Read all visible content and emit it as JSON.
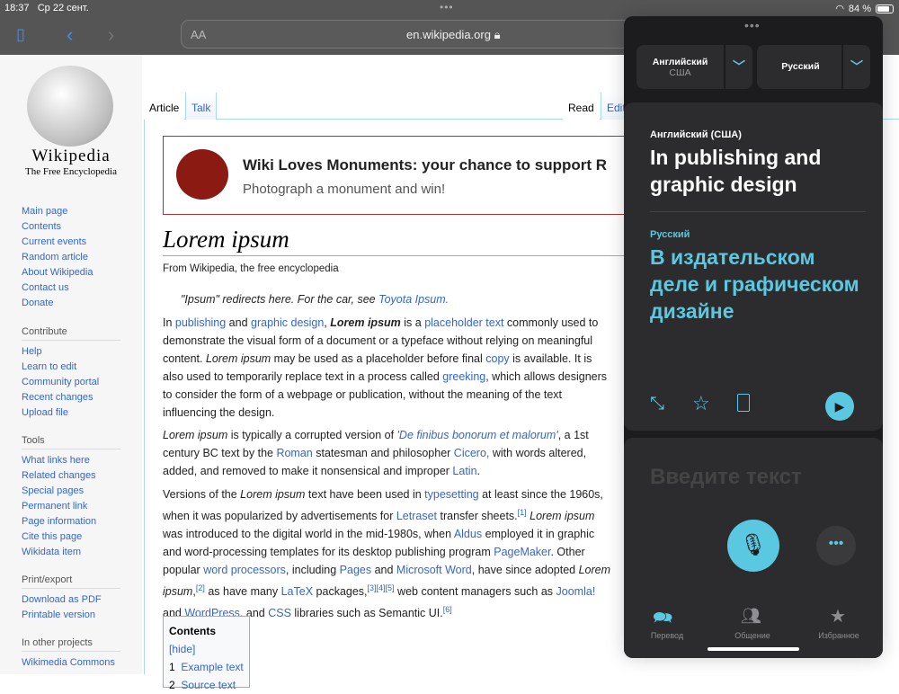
{
  "status": {
    "time": "18:37",
    "date": "Ср 22 сент.",
    "battery": "84 %",
    "battery_level": 0.84
  },
  "browser": {
    "text_size": "AA",
    "url": "en.wikipedia.org"
  },
  "wiki": {
    "logo_title": "Wikipedia",
    "logo_subtitle": "The Free Encyclopedia",
    "nav": [
      "Main page",
      "Contents",
      "Current events",
      "Random article",
      "About Wikipedia",
      "Contact us",
      "Donate"
    ],
    "contribute": {
      "heading": "Contribute",
      "items": [
        "Help",
        "Learn to edit",
        "Community portal",
        "Recent changes",
        "Upload file"
      ]
    },
    "tools": {
      "heading": "Tools",
      "items": [
        "What links here",
        "Related changes",
        "Special pages",
        "Permanent link",
        "Page information",
        "Cite this page",
        "Wikidata item"
      ]
    },
    "print": {
      "heading": "Print/export",
      "items": [
        "Download as PDF",
        "Printable version"
      ]
    },
    "other": {
      "heading": "In other projects",
      "items": [
        "Wikimedia Commons"
      ]
    },
    "tabs": {
      "article": "Article",
      "talk": "Talk",
      "read": "Read",
      "edit": "Edit"
    },
    "banner": {
      "title": "Wiki Loves Monuments: your chance to support R",
      "subtitle": "Photograph a monument and win!"
    },
    "title": "Lorem ipsum",
    "from": "From Wikipedia, the free encyclopedia",
    "hatnote": [
      {
        "t": "\"Ipsum\" redirects here. For the car, see "
      },
      {
        "t": "Toyota Ipsum.",
        "l": 1
      }
    ],
    "paragraphs": [
      [
        {
          "t": "In "
        },
        {
          "t": "publishing",
          "l": 1
        },
        {
          "t": " and "
        },
        {
          "t": "graphic design",
          "l": 1
        },
        {
          "t": ", "
        },
        {
          "t": "Lorem ipsum",
          "b": 1,
          "i": 1
        },
        {
          "t": " is a "
        },
        {
          "t": "placeholder text",
          "l": 1
        },
        {
          "t": " commonly used to demonstrate the visual form of a document or a typeface without relying on meaningful content. "
        },
        {
          "t": "Lorem ipsum",
          "i": 1
        },
        {
          "t": " may be used as a placeholder before final "
        },
        {
          "t": "copy",
          "l": 1
        },
        {
          "t": " is available. It is also used to temporarily replace text in a process called "
        },
        {
          "t": "greeking",
          "l": 1
        },
        {
          "t": ", which allows designers to consider the form of a webpage or publication, without the meaning of the text influencing the design."
        }
      ],
      [
        {
          "t": "Lorem ipsum",
          "i": 1
        },
        {
          "t": " is typically a corrupted version of "
        },
        {
          "t": "'De finibus bonorum et malorum'",
          "l": 1,
          "i": 1
        },
        {
          "t": ", a 1st century BC text by the "
        },
        {
          "t": "Roman",
          "l": 1
        },
        {
          "t": " statesman and philosopher "
        },
        {
          "t": "Cicero,",
          "l": 1
        },
        {
          "t": " with words altered, added, and removed to make it nonsensical and improper "
        },
        {
          "t": "Latin",
          "l": 1
        },
        {
          "t": "."
        }
      ],
      [
        {
          "t": "Versions of the "
        },
        {
          "t": "Lorem ipsum",
          "i": 1
        },
        {
          "t": " text have been used in "
        },
        {
          "t": "typesetting",
          "l": 1
        },
        {
          "t": " at least since the 1960s, when it was popularized by advertisements for "
        },
        {
          "t": "Letraset",
          "l": 1
        },
        {
          "t": " transfer sheets."
        },
        {
          "t": "[1]",
          "s": 1
        },
        {
          "t": " "
        },
        {
          "t": "Lorem ipsum",
          "i": 1
        },
        {
          "t": " was introduced to the digital world in the mid-1980s, when "
        },
        {
          "t": "Aldus",
          "l": 1
        },
        {
          "t": " employed it in graphic and word-processing templates for its desktop publishing program "
        },
        {
          "t": "PageMaker",
          "l": 1
        },
        {
          "t": ". Other popular "
        },
        {
          "t": "word processors",
          "l": 1
        },
        {
          "t": ", including "
        },
        {
          "t": "Pages",
          "l": 1
        },
        {
          "t": " and "
        },
        {
          "t": "Microsoft Word",
          "l": 1
        },
        {
          "t": ", have since adopted "
        },
        {
          "t": "Lorem ipsum",
          "i": 1
        },
        {
          "t": ","
        },
        {
          "t": "[2]",
          "s": 1
        },
        {
          "t": " as have many "
        },
        {
          "t": "LaTeX",
          "l": 1
        },
        {
          "t": " packages,"
        },
        {
          "t": "[3][4][5]",
          "s": 1
        },
        {
          "t": " web content managers such as "
        },
        {
          "t": "Joomla!",
          "l": 1
        },
        {
          "t": " and "
        },
        {
          "t": "WordPress",
          "l": 1
        },
        {
          "t": ", and "
        },
        {
          "t": "CSS",
          "l": 1
        },
        {
          "t": " libraries such as Semantic UI."
        },
        {
          "t": "[6]",
          "s": 1
        }
      ]
    ],
    "toc": {
      "title": "Contents",
      "hide": "[hide]",
      "items": [
        {
          "n": "1",
          "label": "Example text"
        },
        {
          "n": "2",
          "label": "Source text"
        }
      ]
    }
  },
  "translate": {
    "source_lang": "Английский",
    "source_region": "США",
    "target_lang": "Русский",
    "source_label": "Английский (США)",
    "source_text": "In publishing and graphic design",
    "target_label": "Русский",
    "target_text": "В издательском деле и графическом дизайне",
    "input_placeholder": "Введите текст",
    "tabs": [
      "Перевод",
      "Общение",
      "Избранное"
    ],
    "accent": "#5ac8e0"
  }
}
